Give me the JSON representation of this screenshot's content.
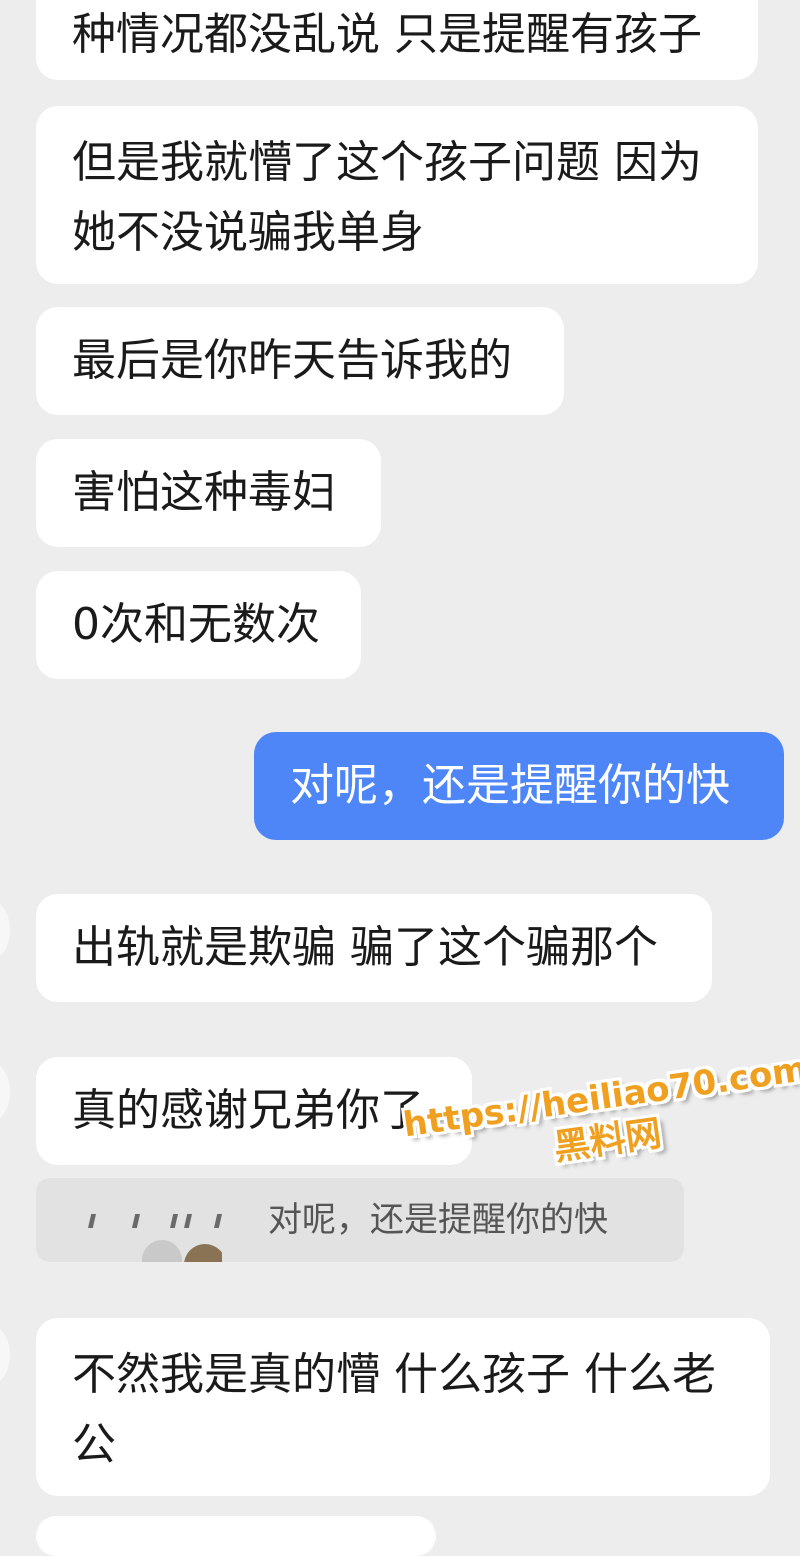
{
  "messages": [
    {
      "side": "left",
      "lines": [
        "种情况都没乱说 只是提醒有孩子"
      ]
    },
    {
      "side": "left",
      "lines": [
        "但是我就懵了这个孩子问题 因为",
        "她不没说骗我单身"
      ]
    },
    {
      "side": "left",
      "lines": [
        "最后是你昨天告诉我的"
      ]
    },
    {
      "side": "left",
      "lines": [
        "害怕这种毒妇"
      ]
    },
    {
      "side": "left",
      "lines": [
        "0次和无数次"
      ]
    },
    {
      "side": "right",
      "lines": [
        "对呢，还是提醒你的快"
      ]
    },
    {
      "side": "left",
      "lines": [
        "出轨就是欺骗 骗了这个骗那个"
      ]
    },
    {
      "side": "left",
      "lines": [
        "真的感谢兄弟你了"
      ]
    },
    {
      "side": "left",
      "lines": [
        "不然我是真的懵 什么孩子 什么老",
        "公"
      ]
    }
  ],
  "quote": {
    "text": "对呢，还是提醒你的快"
  },
  "watermark": {
    "url": "https://heiliao70.com",
    "name": "黑料网"
  },
  "colors": {
    "background": "#ededed",
    "left_bubble": "#ffffff",
    "right_bubble": "#4f86f7",
    "watermark": "#f0a020"
  }
}
